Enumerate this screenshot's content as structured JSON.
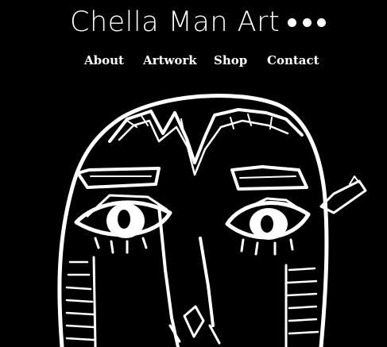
{
  "header": {
    "site_title": "Chella Man Art",
    "menu_icon": "more-dots-icon"
  },
  "nav": {
    "items": [
      {
        "label": "About"
      },
      {
        "label": "Artwork"
      },
      {
        "label": "Shop"
      },
      {
        "label": "Contact"
      }
    ]
  },
  "colors": {
    "background": "#000000",
    "foreground": "#ffffff"
  }
}
